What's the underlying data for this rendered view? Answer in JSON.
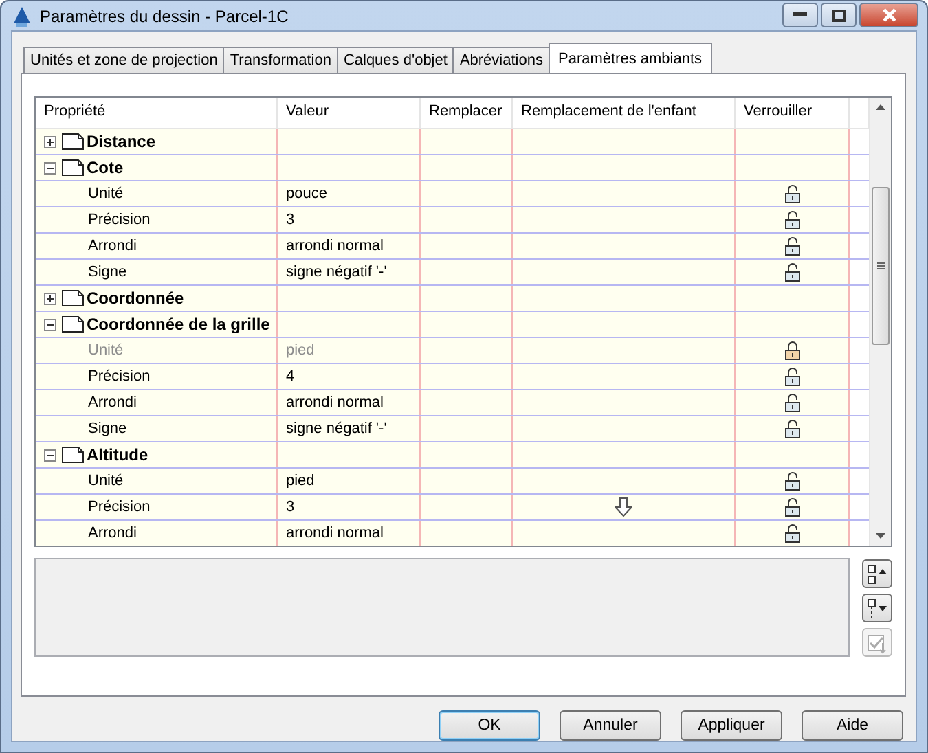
{
  "window": {
    "title": "Paramètres du dessin - Parcel-1C"
  },
  "tabs": [
    {
      "label": "Unités et zone de projection",
      "selected": false
    },
    {
      "label": "Transformation",
      "selected": false
    },
    {
      "label": "Calques d'objet",
      "selected": false
    },
    {
      "label": "Abréviations",
      "selected": false
    },
    {
      "label": "Paramètres ambiants",
      "selected": true
    }
  ],
  "grid": {
    "columns": [
      "Propriété",
      "Valeur",
      "Remplacer",
      "Remplacement de l'enfant",
      "Verrouiller"
    ],
    "rows": [
      {
        "label": "Distance",
        "expanded": false,
        "children": []
      },
      {
        "label": "Cote",
        "expanded": true,
        "children": [
          {
            "label": "Unité",
            "value": "pouce",
            "disabled": false,
            "locked": false,
            "child_override": false
          },
          {
            "label": "Précision",
            "value": "3",
            "disabled": false,
            "locked": false,
            "child_override": false
          },
          {
            "label": "Arrondi",
            "value": "arrondi normal",
            "disabled": false,
            "locked": false,
            "child_override": false
          },
          {
            "label": "Signe",
            "value": "signe négatif '-'",
            "disabled": false,
            "locked": false,
            "child_override": false
          }
        ]
      },
      {
        "label": "Coordonnée",
        "expanded": false,
        "children": []
      },
      {
        "label": "Coordonnée de la grille",
        "expanded": true,
        "children": [
          {
            "label": "Unité",
            "value": "pied",
            "disabled": true,
            "locked": true,
            "child_override": false
          },
          {
            "label": "Précision",
            "value": "4",
            "disabled": false,
            "locked": false,
            "child_override": false
          },
          {
            "label": "Arrondi",
            "value": "arrondi normal",
            "disabled": false,
            "locked": false,
            "child_override": false
          },
          {
            "label": "Signe",
            "value": "signe négatif '-'",
            "disabled": false,
            "locked": false,
            "child_override": false
          }
        ]
      },
      {
        "label": "Altitude",
        "expanded": true,
        "children": [
          {
            "label": "Unité",
            "value": "pied",
            "disabled": false,
            "locked": false,
            "child_override": false
          },
          {
            "label": "Précision",
            "value": "3",
            "disabled": false,
            "locked": false,
            "child_override": true
          },
          {
            "label": "Arrondi",
            "value": "arrondi normal",
            "disabled": false,
            "locked": false,
            "child_override": false
          }
        ]
      }
    ]
  },
  "side_buttons": [
    {
      "kind": "move-up",
      "disabled": false
    },
    {
      "kind": "move-down",
      "disabled": false
    },
    {
      "kind": "check",
      "disabled": true
    }
  ],
  "buttons": [
    "OK",
    "Annuler",
    "Appliquer",
    "Aide"
  ]
}
